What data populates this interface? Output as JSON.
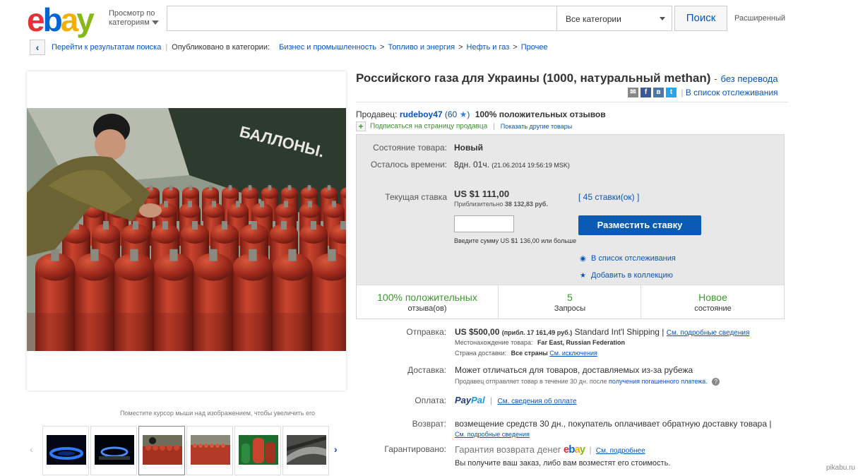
{
  "header": {
    "logo": {
      "e": "e",
      "b": "b",
      "a": "a",
      "y": "y"
    },
    "browse_line1": "Просмотр по",
    "browse_line2": "категориям",
    "search_value": "",
    "category_select": "Все категории",
    "search_button": "Поиск",
    "advanced": "Расширенный"
  },
  "breadcrumb": {
    "back_link": "Перейти к результатам поиска",
    "published_in": "Опубликовано в категории:",
    "items": [
      "Бизнес и промышленность",
      "Топливо и энергия",
      "Нефть и газ",
      "Прочее"
    ]
  },
  "gallery": {
    "hover_note": "Поместите курсор мыши над изображением, чтобы увеличить его"
  },
  "item": {
    "title": "Российского газа для Украины (1000, натуральный methan)",
    "title_dash": "-",
    "untranslated": "без перевода",
    "watchlist_link": "В список отслеживания",
    "share_icons": [
      "mail-icon",
      "facebook-icon",
      "vk-icon",
      "twitter-icon"
    ]
  },
  "seller": {
    "label": "Продавец:",
    "name": "rudeboy47",
    "score": "(60",
    "score_close": ")",
    "positive": "100% положительных отзывов",
    "subscribe": "Подписаться на страницу продавца",
    "other_items": "Показать другие товары"
  },
  "bid_box": {
    "condition_label": "Состояние товара:",
    "condition_value": "Новый",
    "time_label": "Осталось времени:",
    "time_value": "8дн. 01ч.",
    "time_end": "(21.06.2014  19:56:19 MSK)",
    "current_bid_label": "Текущая ставка",
    "current_bid_value": "US $1 111,00",
    "approx_prefix": "Приблизительно",
    "approx_value": "38 132,83 руб.",
    "bids_count": "[ 45 ставки(ок) ]",
    "bid_input_value": "",
    "place_bid": "Разместить ставку",
    "enter_amount": "Введите сумму US $1 136,00 или больше",
    "add_watch": "В список отслеживания",
    "add_collection": "Добавить в коллекцию"
  },
  "stats": [
    {
      "big": "100% положительных",
      "small": "отзыва(ов)"
    },
    {
      "big": "5",
      "small": "Запросы"
    },
    {
      "big": "Новое",
      "small": "состояние"
    }
  ],
  "shipping": {
    "label": "Отправка:",
    "price": "US $500,00",
    "approx": "(прибл. 17 161,49 руб.)",
    "method": "Standard Int'l Shipping |",
    "details_link": "См. подробные сведения",
    "location_label": "Местонахождение товара:",
    "location": "Far East, Russian Federation",
    "country_label": "Страна доставки:",
    "country": "Все страны",
    "exceptions_link": "См. исключения"
  },
  "delivery": {
    "label": "Доставка:",
    "text": "Может отличаться для товаров, доставляемых из-за рубежа",
    "note": "Продавец отправляет товар в течение 30 дн. после",
    "note_link": "получения погашенного платежа."
  },
  "payment": {
    "label": "Оплата:",
    "paypal_1": "Pay",
    "paypal_2": "Pal",
    "link": "См. сведения об оплате"
  },
  "returns": {
    "label": "Возврат:",
    "text": "возмещение средств 30 дн., покупатель оплачивает обратную доставку товара |",
    "link": "См. подробные сведения"
  },
  "guarantee": {
    "label": "Гарантировано:",
    "text": "Гарантия возврата денег",
    "link": "См. подробнее",
    "note": "Вы получите ваш заказ, либо вам возместят его стоимость."
  },
  "watermark": "pikabu.ru"
}
